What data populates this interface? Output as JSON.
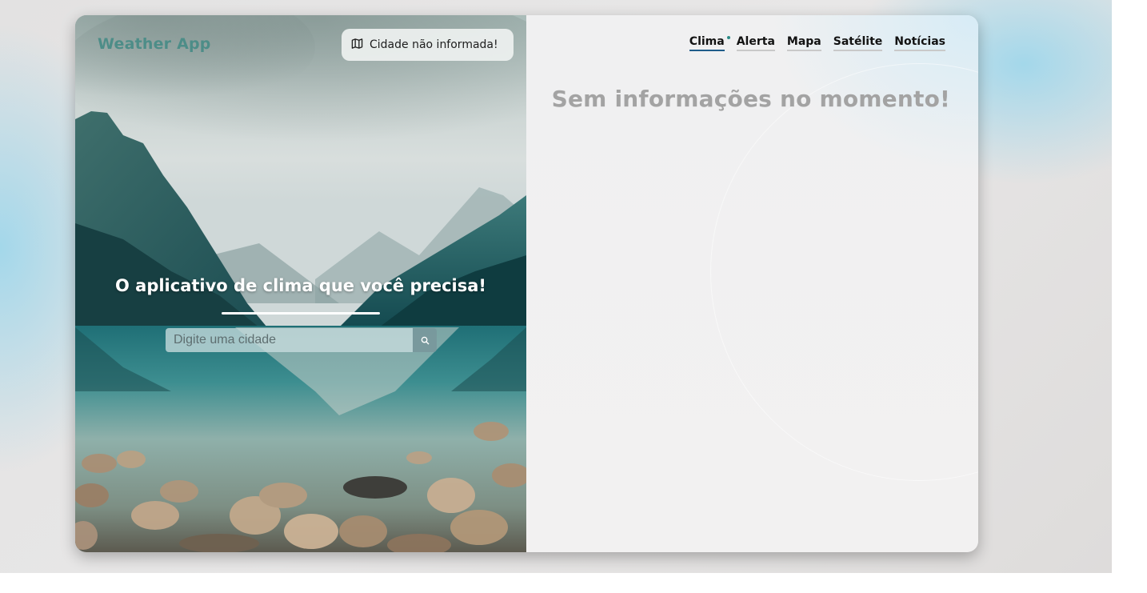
{
  "brand": {
    "name": "Weather App"
  },
  "location": {
    "status_text": "Cidade não informada!"
  },
  "hero": {
    "title": "O aplicativo de clima que você precisa!",
    "search_placeholder": "Digite uma cidade",
    "search_value": ""
  },
  "nav": {
    "items": [
      {
        "label": "Clima",
        "active": true
      },
      {
        "label": "Alerta",
        "active": false
      },
      {
        "label": "Mapa",
        "active": false
      },
      {
        "label": "Satélite",
        "active": false
      },
      {
        "label": "Notícias",
        "active": false
      }
    ]
  },
  "content": {
    "empty_message": "Sem informações no momento!"
  },
  "icons": {
    "location": "map-icon",
    "search": "search-icon"
  },
  "colors": {
    "brand": "#4d8d88",
    "active_nav_underline": "#1e5c8a",
    "active_dot": "#2b8a86",
    "empty_message": "#a3a3a3"
  }
}
